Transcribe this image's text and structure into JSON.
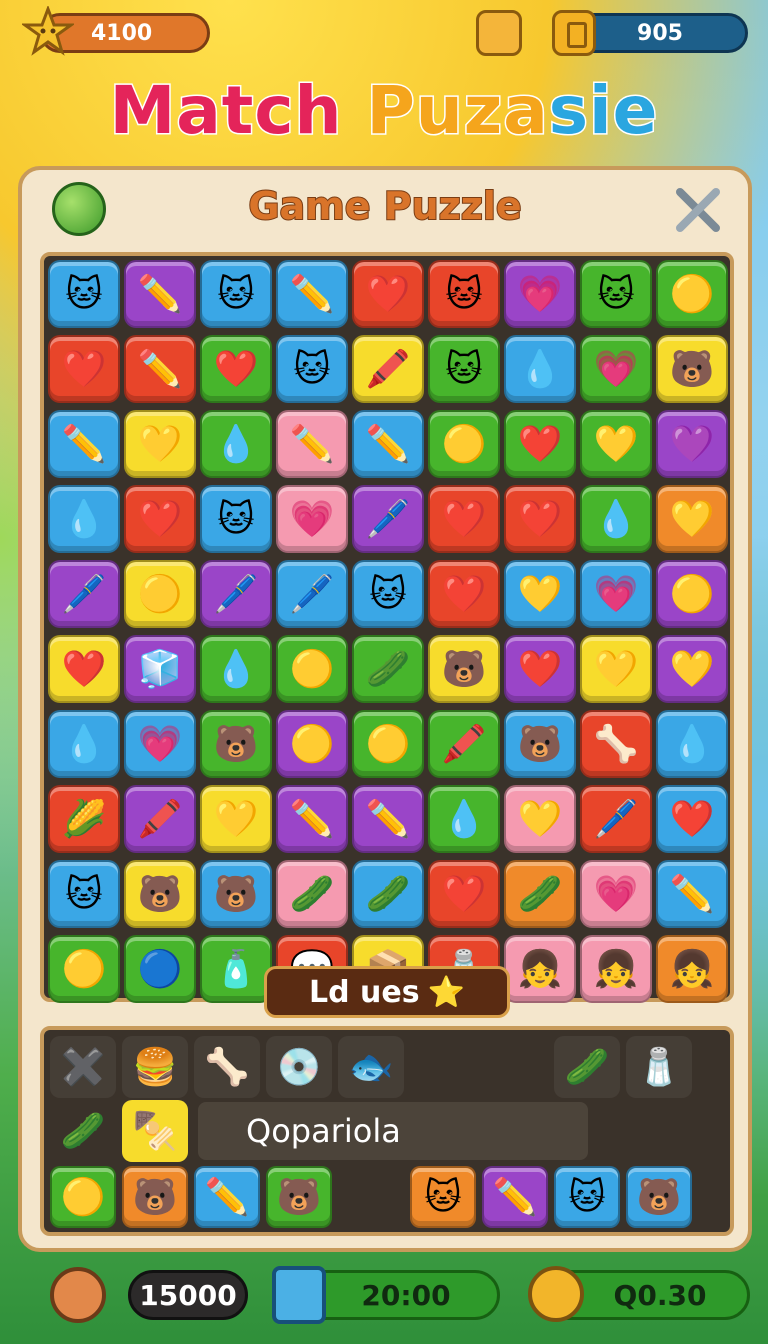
{
  "header": {
    "score": "4100",
    "coins": "905",
    "star_icon": "star-icon",
    "bow_icon": "bow-icon",
    "coin_icon": "coin-icon"
  },
  "title": {
    "part1": "Match ",
    "part2": "Puza",
    "part3": "sie"
  },
  "panel": {
    "subtitle": "Game Puzzle",
    "apple_icon": "apple-icon",
    "tools_icon": "tools-icon"
  },
  "board": {
    "colors": {
      "b": "#3aa7e6",
      "p": "#9a45c8",
      "g": "#47b52c",
      "r": "#e8452a",
      "y": "#f7dc2c",
      "o": "#f08a2a",
      "k": "#f59ab0"
    },
    "rows": [
      [
        [
          "b",
          "🐱"
        ],
        [
          "p",
          "✏️"
        ],
        [
          "b",
          "🐱"
        ],
        [
          "b",
          "✏️"
        ],
        [
          "r",
          "❤️"
        ],
        [
          "r",
          "🐱"
        ],
        [
          "p",
          "💗"
        ],
        [
          "g",
          "🐱"
        ],
        [
          "g",
          "🟡"
        ]
      ],
      [
        [
          "r",
          "❤️"
        ],
        [
          "r",
          "✏️"
        ],
        [
          "g",
          "❤️"
        ],
        [
          "b",
          "🐱"
        ],
        [
          "y",
          "🖍️"
        ],
        [
          "g",
          "🐱"
        ],
        [
          "b",
          "💧"
        ],
        [
          "g",
          "💗"
        ],
        [
          "y",
          "🐻"
        ]
      ],
      [
        [
          "b",
          "✏️"
        ],
        [
          "y",
          "💛"
        ],
        [
          "g",
          "💧"
        ],
        [
          "k",
          "✏️"
        ],
        [
          "b",
          "✏️"
        ],
        [
          "g",
          "🟡"
        ],
        [
          "g",
          "❤️"
        ],
        [
          "g",
          "💛"
        ],
        [
          "p",
          "💜"
        ]
      ],
      [
        [
          "b",
          "💧"
        ],
        [
          "r",
          "❤️"
        ],
        [
          "b",
          "🐱"
        ],
        [
          "k",
          "💗"
        ],
        [
          "p",
          "🖊️"
        ],
        [
          "r",
          "❤️"
        ],
        [
          "r",
          "❤️"
        ],
        [
          "g",
          "💧"
        ],
        [
          "o",
          "💛"
        ]
      ],
      [
        [
          "p",
          "🖊️"
        ],
        [
          "y",
          "🟡"
        ],
        [
          "p",
          "🖊️"
        ],
        [
          "b",
          "🖊️"
        ],
        [
          "b",
          "🐱"
        ],
        [
          "r",
          "❤️"
        ],
        [
          "b",
          "💛"
        ],
        [
          "b",
          "💗"
        ],
        [
          "p",
          "🟡"
        ]
      ],
      [
        [
          "y",
          "❤️"
        ],
        [
          "p",
          "🧊"
        ],
        [
          "g",
          "💧"
        ],
        [
          "g",
          "🟡"
        ],
        [
          "g",
          "🥒"
        ],
        [
          "y",
          "🐻"
        ],
        [
          "p",
          "❤️"
        ],
        [
          "y",
          "💛"
        ],
        [
          "p",
          "💛"
        ]
      ],
      [
        [
          "b",
          "💧"
        ],
        [
          "b",
          "💗"
        ],
        [
          "g",
          "🐻"
        ],
        [
          "p",
          "🟡"
        ],
        [
          "g",
          "🟡"
        ],
        [
          "g",
          "🖍️"
        ],
        [
          "b",
          "🐻"
        ],
        [
          "r",
          "🦴"
        ],
        [
          "b",
          "💧"
        ]
      ],
      [
        [
          "r",
          "🌽"
        ],
        [
          "p",
          "🖍️"
        ],
        [
          "y",
          "💛"
        ],
        [
          "p",
          "✏️"
        ],
        [
          "p",
          "✏️"
        ],
        [
          "g",
          "💧"
        ],
        [
          "k",
          "💛"
        ],
        [
          "r",
          "🖊️"
        ],
        [
          "b",
          "❤️"
        ]
      ],
      [
        [
          "b",
          "🐱"
        ],
        [
          "y",
          "🐻"
        ],
        [
          "b",
          "🐻"
        ],
        [
          "k",
          "🥒"
        ],
        [
          "b",
          "🥒"
        ],
        [
          "r",
          "❤️"
        ],
        [
          "o",
          "🥒"
        ],
        [
          "k",
          "💗"
        ],
        [
          "b",
          "✏️"
        ]
      ],
      [
        [
          "g",
          "🟡"
        ],
        [
          "g",
          "🔵"
        ],
        [
          "g",
          "🧴"
        ],
        [
          "r",
          "💬"
        ],
        [
          "y",
          "📦"
        ],
        [
          "r",
          "🧂"
        ],
        [
          "k",
          "👧"
        ],
        [
          "k",
          "👧"
        ],
        [
          "o",
          "👧"
        ]
      ]
    ]
  },
  "banner": {
    "text": "Ld ues",
    "star": "⭐"
  },
  "tray": {
    "row1": [
      "✖️",
      "🍔",
      "🦴",
      "💿",
      "🐟",
      "",
      "",
      "🥒",
      "🧂"
    ],
    "label": "Qopariola",
    "row2_left": [
      "🥒",
      "🍢"
    ],
    "row3": [
      [
        "g",
        "🟡"
      ],
      [
        "o",
        "🐻"
      ],
      [
        "b",
        "✏️"
      ],
      [
        "g",
        "🐻"
      ],
      [
        "",
        ""
      ],
      [
        "o",
        "🐱"
      ],
      [
        "p",
        "✏️"
      ],
      [
        "b",
        "🐱"
      ],
      [
        "b",
        "🐻"
      ]
    ]
  },
  "footer": {
    "moves": "15000",
    "time": "20:00",
    "goal": "Q0.30",
    "moves_icon": "triangle-icon",
    "time_icon": "cup-icon",
    "goal_icon": "key-icon"
  }
}
